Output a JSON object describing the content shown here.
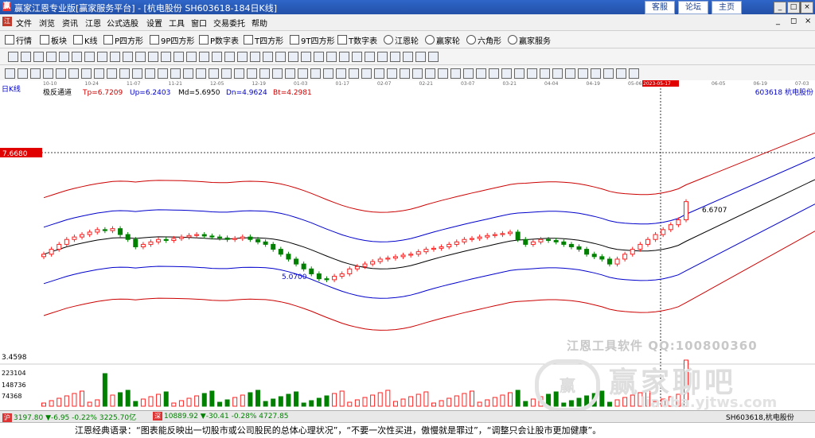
{
  "window": {
    "title": "赢家江恩专业版[赢家服务平台] - [杭电股份  SH603618-184日K线]",
    "links": [
      "客服",
      "论坛",
      "主页"
    ],
    "controls": [
      "_",
      "□",
      "×"
    ]
  },
  "menu": {
    "logo": "江",
    "items": [
      "文件",
      "浏览",
      "资讯",
      "江恩",
      "公式选股",
      "设置",
      "工具",
      "窗口",
      "交易委托",
      "帮助"
    ],
    "mdi_controls": [
      "_",
      "◻",
      "×"
    ]
  },
  "toolbar": {
    "items": [
      "行情",
      "板块",
      "K线",
      "P四方形",
      "9P四方形",
      "P数字表",
      "T四方形",
      "9T四方形",
      "T数字表",
      "江恩轮",
      "赢家轮",
      "六角形",
      "赢家服务"
    ]
  },
  "chart": {
    "period_label": "日K线",
    "date_ticks": [
      "10-10",
      "10-24",
      "11-07",
      "11-21",
      "12-05",
      "12-19",
      "01-03",
      "01-17",
      "02-07",
      "02-21",
      "03-07",
      "03-21",
      "04-04",
      "04-19",
      "05-06",
      "2023-05-17",
      "06-05",
      "06-19",
      "07-03"
    ],
    "indicator": {
      "name": "极反通道",
      "tp": "Tp=6.7209",
      "up": "Up=6.2403",
      "md": "Md=5.6950",
      "dn": "Dn=4.9624",
      "bt": "Bt=4.2981"
    },
    "stock": "603618  杭电股份",
    "crosshair_price": "7.6680",
    "bottom_price": "3.4598",
    "high_label": "6.6707",
    "low_label": "5.0700",
    "volume_axis": [
      "223104",
      "148736",
      "74368"
    ],
    "colors": {
      "up": "#ff2020",
      "down": "#008000",
      "tp": "#cc0000",
      "up_band": "#0000cc",
      "md": "#000000",
      "volume_up": "#ff2020",
      "volume_down": "#008000"
    }
  },
  "chart_data": {
    "type": "candlestick",
    "price_range": [
      3.4598,
      7.668
    ],
    "close_series": [
      5.6,
      5.7,
      5.8,
      5.9,
      5.95,
      6.0,
      6.05,
      6.1,
      6.08,
      6.12,
      6.0,
      5.9,
      5.75,
      5.8,
      5.85,
      5.9,
      5.88,
      5.92,
      5.95,
      5.98,
      6.0,
      5.97,
      5.95,
      5.93,
      5.9,
      5.92,
      5.95,
      5.9,
      5.85,
      5.8,
      5.7,
      5.6,
      5.5,
      5.4,
      5.3,
      5.2,
      5.1,
      5.08,
      5.15,
      5.2,
      5.3,
      5.35,
      5.4,
      5.45,
      5.5,
      5.52,
      5.55,
      5.58,
      5.6,
      5.65,
      5.7,
      5.72,
      5.75,
      5.8,
      5.85,
      5.9,
      5.92,
      5.95,
      5.98,
      6.0,
      6.02,
      6.05,
      5.9,
      5.8,
      5.85,
      5.9,
      5.88,
      5.85,
      5.8,
      5.75,
      5.7,
      5.6,
      5.55,
      5.5,
      5.4,
      5.5,
      5.6,
      5.7,
      5.8,
      5.9,
      6.0,
      6.1,
      6.2,
      6.3,
      6.67
    ]
  },
  "watermark": {
    "line1": "江恩工具软件  QQ:100800360",
    "line2": "赢家聊吧",
    "line3": "liaoba.yjtws.com",
    "logo": "赢"
  },
  "statusbar": {
    "index1_tag": "沪",
    "index1": "3197.80 ▼-6.95 -0.22% 3225.70亿",
    "index2_tag": "深",
    "index2": "10889.92 ▼-30.41 -0.28% 4727.85",
    "current": "SH603618,杭电股份"
  },
  "quote": "江恩经典语录：“图表能反映出一切股市或公司股民的总体心理状况”，“不要一次性买进，傲慢就是罪过”，“调整只会让股市更加健康”。"
}
